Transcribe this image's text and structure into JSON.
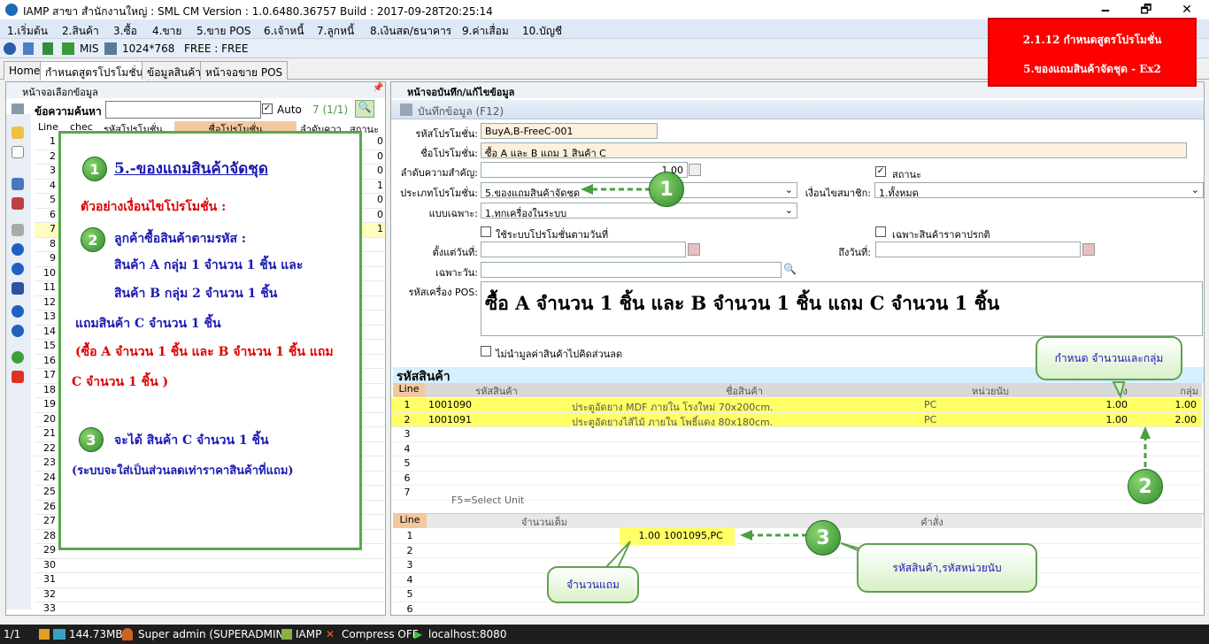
{
  "window": {
    "title": "IAMP สาขา สำนักงานใหญ่ : SML CM Version : 1.0.6480.36757  Build : 2017-09-28T20:25:14",
    "minimize": "🗕",
    "maximize": "🗗",
    "close": "✕"
  },
  "menu": [
    "1.เริ่มต้น",
    "2.สินค้า",
    "3.ซื้อ",
    "4.ขาย",
    "5.ขาย POS",
    "6.เจ้าหนี้",
    "7.ลูกหนี้",
    "8.เงินสด/ธนาคาร",
    "9.ค่าเสื่อม",
    "10.บัญชี"
  ],
  "toolbar": {
    "mis": "MIS",
    "resolution": "1024*768",
    "free": "FREE : FREE"
  },
  "tabs": [
    "Home",
    "กำหนดสูตรโปรโมชั่น",
    "ข้อมูลสินค้า",
    "หน้าจอขาย POS"
  ],
  "left_panel": {
    "title": "หน้าจอเลือกข้อมูล",
    "search_label": "ข้อความค้นหา",
    "auto_label": "Auto",
    "count": "7 (1/1)",
    "columns": [
      "Line",
      "chec",
      "รหัสโปรโมชั่น",
      "ชื่อโปรโมชั่น",
      "ลำดับควา",
      "สถานะ"
    ],
    "rows": [
      "1",
      "2",
      "3",
      "4",
      "5",
      "6",
      "7",
      "8",
      "9",
      "10",
      "11",
      "12",
      "13",
      "14",
      "15",
      "16",
      "17",
      "18",
      "19",
      "20",
      "21",
      "22",
      "23",
      "24",
      "25",
      "26",
      "27",
      "28",
      "29",
      "30",
      "31",
      "32",
      "33"
    ],
    "status": [
      "0",
      "0",
      "0",
      "1",
      "0",
      "0",
      "1"
    ]
  },
  "overlay": {
    "heading": "5.-ของแถมสินค้าจัดชุด",
    "example": "ตัวอย่างเงื่อนไขโปรโมชั่น  :",
    "step2": "ลูกค้าซื้อสินค้าตามรหัส :",
    "line_a": "สินค้า A กลุ่ม 1 จำนวน 1 ชิ้น  และ",
    "line_b": "สินค้า B กลุ่ม 2 จำนวน  1 ชิ้น",
    "line_c": "แถมสินค้า C  จำนวน 1 ชิ้น",
    "red1": "(ซื้อ A จำนวน 1 ชิ้น และ B จำนวน 1 ชิ้น  แถม",
    "red2": "C จำนวน 1 ชิ้น  )",
    "step3": "จะได้ สินค้า C จำนวน 1 ชิ้น",
    "note": "(ระบบจะใส่เป็นส่วนลดเท่าราคาสินค้าที่แถม)",
    "n1": "1",
    "n2": "2",
    "n3": "3"
  },
  "right_panel": {
    "title": "หน้าจอบันทึก/แก้ไขข้อมูล",
    "save": "บันทึกข้อมูล (F12)",
    "code_label": "รหัสโปรโมชั่น:",
    "code": "BuyA,B-FreeC-001",
    "name_label": "ชื่อโปรโมชั่น:",
    "name": "ซื้อ A และ B  แถม 1 สินค้า C",
    "priority_label": "ลำดับความสำคัญ:",
    "priority": "1.00",
    "status_label": "สถานะ",
    "type_label": "ประเภทโปรโมชั่น:",
    "type": "5.ของแถมสินค้าจัดชุด",
    "member_label": "เงื่อนไขสมาชิก:",
    "member": "1.ทั้งหมด",
    "mode_label": "แบบเฉพาะ:",
    "mode": "1.ทุกเครื่องในระบบ",
    "use_date": "ใช้ระบบโปรโมชั่นตามวันที่",
    "normal_price": "เฉพาะสินค้าราคาปรกติ",
    "from_label": "ตั้งแต่วันที่:",
    "to_label": "ถึงวันที่:",
    "day_label": "เฉพาะวัน:",
    "pos_label": "รหัสเครื่อง POS:",
    "pos_text": "ซื้อ A จำนวน 1 ชิ้น และ B จำนวน 1 ชิ้น  แถม C จำนวน 1 ชิ้น",
    "no_discount": "ไม่นำมูลค่าสินค้าไปคิดส่วนลด"
  },
  "products": {
    "title": "รหัสสินค้า",
    "columns": [
      "Line",
      "รหัสสินค้า",
      "ชื่อสินค้า",
      "หน่วยนับ",
      "ถึง",
      "กลุ่ม"
    ],
    "rows": [
      {
        "line": "1",
        "code": "1001090",
        "name": "ประตูอัดยาง MDF ภายใน โรงใหม่ 70x200cm.",
        "unit": "PC",
        "qty": "1.00",
        "group": "1.00"
      },
      {
        "line": "2",
        "code": "1001091",
        "name": "ประตูอัดยางไส้ไม้ ภายใน โพธิ์แดง 80x180cm.",
        "unit": "PC",
        "qty": "1.00",
        "group": "2.00"
      },
      {
        "line": "3"
      },
      {
        "line": "4"
      },
      {
        "line": "5"
      },
      {
        "line": "6"
      },
      {
        "line": "7"
      }
    ],
    "hint": "F5=Select Unit"
  },
  "free": {
    "columns": [
      "Line",
      "จำนวนเต็ม",
      "คำสั่ง"
    ],
    "rows": [
      {
        "line": "1",
        "qty": "1.00",
        "cmd": "1001095,PC"
      },
      {
        "line": "2"
      },
      {
        "line": "3"
      },
      {
        "line": "4"
      },
      {
        "line": "5"
      },
      {
        "line": "6"
      }
    ]
  },
  "annotations": {
    "redbox1": "2.1.12 กำหนดสูตรโปรโมชั่น",
    "redbox2": "5.ของแถมสินค้าจัดชุด - Ex2",
    "callout_qty_group": "กำหนด จำนวนและกลุ่ม",
    "callout_free_qty": "จำนวนแถม",
    "callout_code_unit": "รหัสสินค้า,รหัสหน่วยนับ",
    "n1": "1",
    "n2": "2",
    "n3": "3"
  },
  "status": {
    "page": "1/1",
    "memory": "144.73MB",
    "user": "Super admin (SUPERADMIN)",
    "app": "IAMP",
    "compress": "Compress OFF",
    "host": "localhost:8080"
  }
}
